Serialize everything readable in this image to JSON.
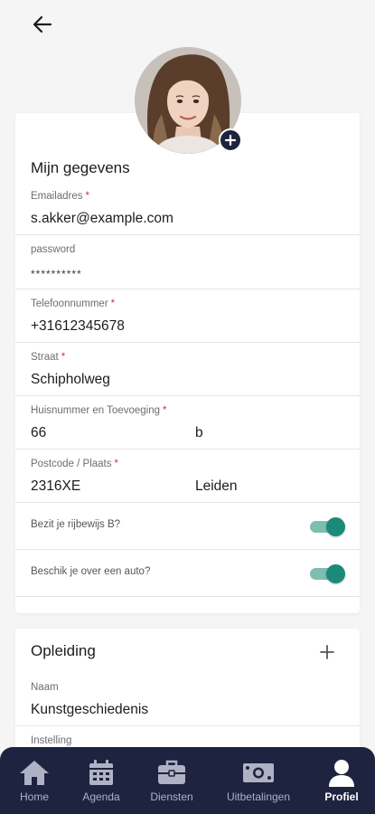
{
  "header": {
    "back_icon": "arrow-left-icon"
  },
  "profile": {
    "avatar_icon": "user-photo",
    "add_icon": "plus-icon"
  },
  "personal": {
    "title": "Mijn gegevens",
    "fields": [
      {
        "label": "Emailadres",
        "required": "*",
        "value": "s.akker@example.com"
      },
      {
        "label": "password",
        "value": "**********"
      },
      {
        "label": "Telefoonnummer",
        "required": "*",
        "value": "+31612345678"
      },
      {
        "label": "Straat",
        "required": "*",
        "value": "Schipholweg"
      },
      {
        "label": "Huisnummer en Toevoeging",
        "required": "*",
        "value": "66",
        "value2": "b"
      },
      {
        "label": "Postcode / Plaats",
        "required": "*",
        "value": "2316XE",
        "value2": "Leiden"
      }
    ],
    "toggles": [
      {
        "label": "Bezit je rijbewijs B?",
        "checked": true
      },
      {
        "label": "Beschik je over een auto?",
        "checked": true
      }
    ]
  },
  "education": {
    "title": "Opleiding",
    "add_icon": "plus-icon",
    "fields": [
      {
        "label": "Naam",
        "value": "Kunstgeschiedenis"
      },
      {
        "label": "Instelling"
      }
    ]
  },
  "bottom_nav": {
    "items": [
      {
        "label": "Home",
        "icon": "home-icon",
        "active": false
      },
      {
        "label": "Agenda",
        "icon": "calendar-icon",
        "active": false
      },
      {
        "label": "Diensten",
        "icon": "briefcase-icon",
        "active": false
      },
      {
        "label": "Uitbetalingen",
        "icon": "money-icon",
        "active": false
      },
      {
        "label": "Profiel",
        "icon": "user-icon",
        "active": true
      }
    ]
  },
  "colors": {
    "accent": "#1b8a78",
    "accent_light": "#7fbdb1",
    "nav_bg": "#1e2340",
    "required": "#d0314c"
  }
}
